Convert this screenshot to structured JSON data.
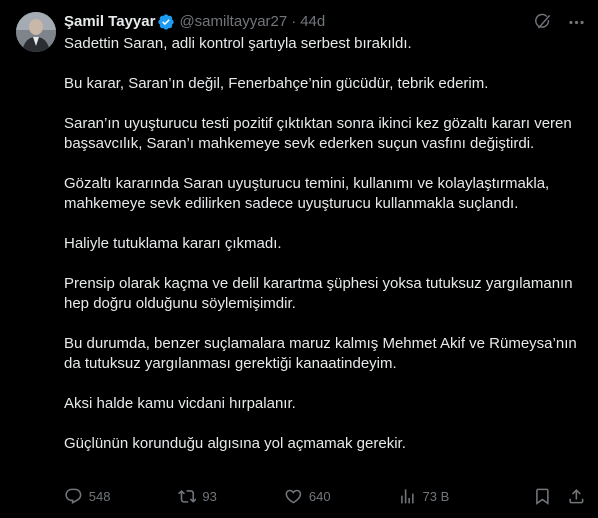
{
  "author": {
    "name": "Şamil Tayyar",
    "handle": "@samiltayyar27",
    "separator": "·",
    "time": "44d"
  },
  "icons": {
    "verified": "verified-badge-icon",
    "grok": "grok-icon",
    "more": "more-icon",
    "reply": "reply-icon",
    "retweet": "retweet-icon",
    "like": "like-icon",
    "views": "views-icon",
    "bookmark": "bookmark-icon",
    "share": "share-icon"
  },
  "colors": {
    "background": "#000000",
    "text": "#e7e9ea",
    "secondary": "#71767b",
    "verified": "#1d9bf0"
  },
  "body": [
    "Sadettin Saran, adli kontrol şartıyla serbest bırakıldı.",
    "Bu karar, Saran’ın değil, Fenerbahçe’nin gücüdür, tebrik ederim.",
    "Saran’ın uyuşturucu testi pozitif çıktıktan sonra ikinci kez gözaltı kararı veren başsavcılık, Saran’ı mahkemeye sevk ederken suçun vasfını değiştirdi.",
    "Gözaltı kararında Saran uyuşturucu temini, kullanımı ve kolaylaştırmakla, mahkemeye sevk edilirken sadece uyuşturucu kullanmakla suçlandı.",
    "Haliyle tutuklama kararı çıkmadı.",
    "Prensip olarak kaçma ve delil karartma şüphesi yoksa tutuksuz yargılamanın hep doğru olduğunu söylemişimdir.",
    "Bu durumda, benzer suçlamalara maruz kalmış Mehmet Akif ve Rümeysa’nın da tutuksuz yargılanması gerektiği kanaatindeyim.",
    "Aksi halde kamu vicdani hırpalanır.",
    "Güçlünün korunduğu algısına yol açmamak gerekir."
  ],
  "actions": {
    "replies": "548",
    "retweets": "93",
    "likes": "640",
    "views": "73 B"
  }
}
